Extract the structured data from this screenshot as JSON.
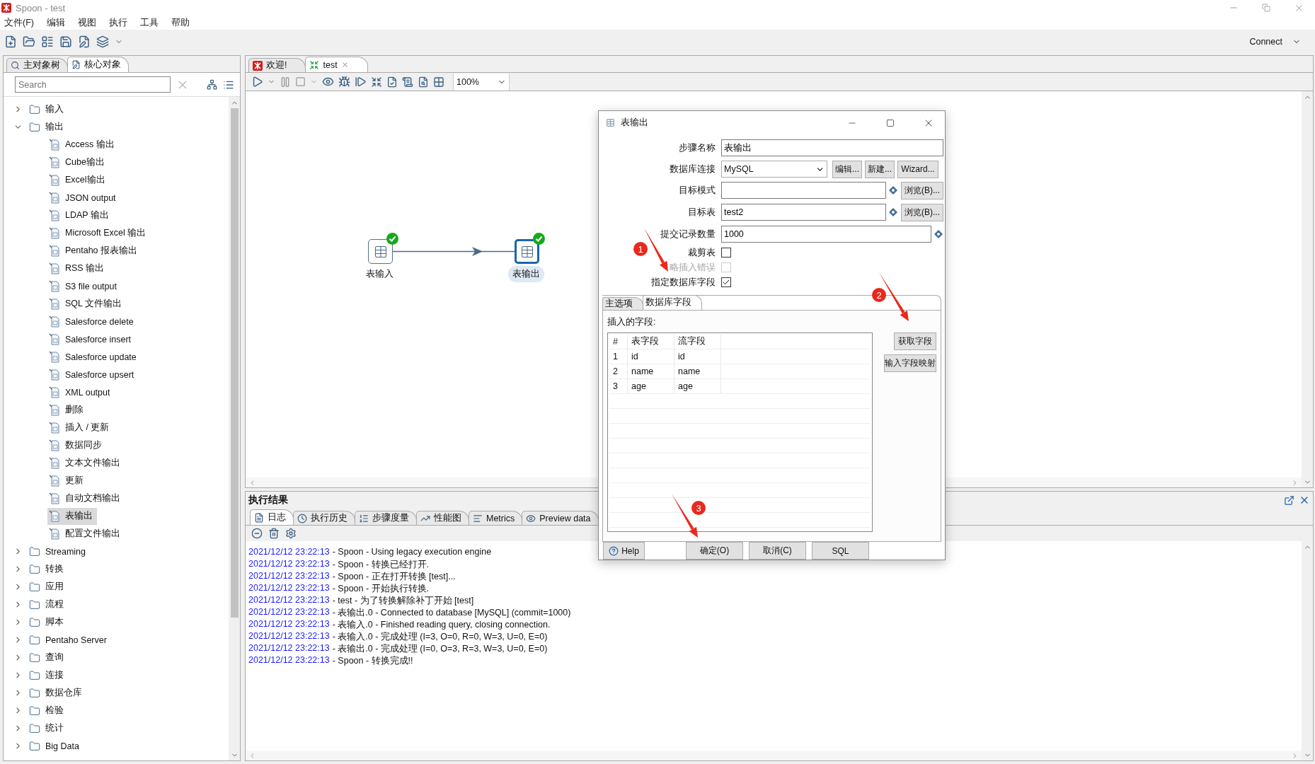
{
  "window": {
    "title": "Spoon - test"
  },
  "menu": [
    "文件(F)",
    "编辑",
    "视图",
    "执行",
    "工具",
    "帮助"
  ],
  "connect": "Connect",
  "left_tabs": [
    {
      "label": "主对象树",
      "selected": false
    },
    {
      "label": "核心对象",
      "selected": true
    }
  ],
  "search": {
    "placeholder": "Search"
  },
  "tree": [
    {
      "label": "输入",
      "expanded": false
    },
    {
      "label": "输出",
      "expanded": true,
      "children": [
        {
          "label": "Access 输出",
          "selected": false
        },
        {
          "label": "Cube输出",
          "selected": false
        },
        {
          "label": "Excel输出",
          "selected": false
        },
        {
          "label": "JSON output",
          "selected": false
        },
        {
          "label": "LDAP 输出",
          "selected": false
        },
        {
          "label": "Microsoft Excel 输出",
          "selected": false
        },
        {
          "label": "Pentaho 报表输出",
          "selected": false
        },
        {
          "label": "RSS 输出",
          "selected": false
        },
        {
          "label": "S3 file output",
          "selected": false
        },
        {
          "label": "SQL 文件输出",
          "selected": false
        },
        {
          "label": "Salesforce delete",
          "selected": false
        },
        {
          "label": "Salesforce insert",
          "selected": false
        },
        {
          "label": "Salesforce update",
          "selected": false
        },
        {
          "label": "Salesforce upsert",
          "selected": false
        },
        {
          "label": "XML output",
          "selected": false
        },
        {
          "label": "删除",
          "selected": false
        },
        {
          "label": "插入 / 更新",
          "selected": false
        },
        {
          "label": "数据同步",
          "selected": false
        },
        {
          "label": "文本文件输出",
          "selected": false
        },
        {
          "label": "更新",
          "selected": false
        },
        {
          "label": "自动文档输出",
          "selected": false
        },
        {
          "label": "表输出",
          "selected": true
        },
        {
          "label": "配置文件输出",
          "selected": false
        }
      ]
    },
    {
      "label": "Streaming",
      "expanded": false
    },
    {
      "label": "转换",
      "expanded": false
    },
    {
      "label": "应用",
      "expanded": false
    },
    {
      "label": "流程",
      "expanded": false
    },
    {
      "label": "脚本",
      "expanded": false
    },
    {
      "label": "Pentaho Server",
      "expanded": false
    },
    {
      "label": "查询",
      "expanded": false
    },
    {
      "label": "连接",
      "expanded": false
    },
    {
      "label": "数据仓库",
      "expanded": false
    },
    {
      "label": "检验",
      "expanded": false
    },
    {
      "label": "统计",
      "expanded": false
    },
    {
      "label": "Big Data",
      "expanded": false
    }
  ],
  "editor_tabs": [
    {
      "label": "欢迎!",
      "selected": false
    },
    {
      "label": "test",
      "selected": true
    }
  ],
  "zoom": "100%",
  "canvas": {
    "nodes": [
      {
        "label": "表输入",
        "selected": false
      },
      {
        "label": "表输出",
        "selected": true
      }
    ]
  },
  "results": {
    "title": "执行结果",
    "tabs": [
      {
        "label": "日志",
        "selected": true
      },
      {
        "label": "执行历史",
        "selected": false
      },
      {
        "label": "步骤度量",
        "selected": false
      },
      {
        "label": "性能图",
        "selected": false
      },
      {
        "label": "Metrics",
        "selected": false
      },
      {
        "label": "Preview data",
        "selected": false
      }
    ],
    "log": [
      {
        "time": "2021/12/12 23:22:13",
        "message": "- Spoon - Using legacy execution engine"
      },
      {
        "time": "2021/12/12 23:22:13",
        "message": "- Spoon - 转换已经打开."
      },
      {
        "time": "2021/12/12 23:22:13",
        "message": "- Spoon - 正在打开转换 [test]..."
      },
      {
        "time": "2021/12/12 23:22:13",
        "message": "- Spoon - 开始执行转换."
      },
      {
        "time": "2021/12/12 23:22:13",
        "message": "- test - 为了转换解除补丁开始  [test]"
      },
      {
        "time": "2021/12/12 23:22:13",
        "message": "- 表输出.0 - Connected to database [MySQL] (commit=1000)"
      },
      {
        "time": "2021/12/12 23:22:13",
        "message": "- 表输入.0 - Finished reading query, closing connection."
      },
      {
        "time": "2021/12/12 23:22:13",
        "message": "- 表输入.0 - 完成处理 (I=3, O=0, R=0, W=3, U=0, E=0)"
      },
      {
        "time": "2021/12/12 23:22:13",
        "message": "- 表输出.0 - 完成处理 (I=0, O=3, R=3, W=3, U=0, E=0)"
      },
      {
        "time": "2021/12/12 23:22:13",
        "message": "- Spoon - 转换完成!!"
      }
    ]
  },
  "dialog": {
    "title": "表输出",
    "rows": [
      {
        "kind": "text",
        "label": "步骤名称",
        "value": "表输出"
      },
      {
        "kind": "select",
        "label": "数据库连接",
        "value": "MySQL",
        "buttons": [
          "编辑...",
          "新建...",
          "Wizard..."
        ]
      },
      {
        "kind": "text",
        "label": "目标模式",
        "variable": true,
        "button": "浏览(B)..."
      },
      {
        "kind": "text",
        "label": "目标表",
        "value": "test2",
        "variable": true,
        "button": "浏览(B)..."
      },
      {
        "kind": "text",
        "label": "提交记录数量",
        "value": "1000",
        "variable": true
      },
      {
        "kind": "checkbox",
        "label": "裁剪表",
        "checked": false,
        "disabled": false
      },
      {
        "kind": "checkbox",
        "label": "略插入错误",
        "checked": false,
        "disabled": true
      },
      {
        "kind": "checkbox",
        "label": "指定数据库字段",
        "checked": true,
        "disabled": false
      }
    ],
    "tabs": [
      {
        "label": "主选项",
        "selected": false
      },
      {
        "label": "数据库字段",
        "selected": true
      }
    ],
    "fields_label": "插入的字段:",
    "table": {
      "columns": [
        "#",
        "表字段",
        "流字段"
      ],
      "rows": [
        [
          "1",
          "id",
          "id"
        ],
        [
          "2",
          "name",
          "name"
        ],
        [
          "3",
          "age",
          "age"
        ]
      ]
    },
    "side_buttons": [
      "获取字段",
      "输入字段映射"
    ],
    "footer": {
      "help": "Help",
      "buttons": [
        "确定(O)",
        "取消(C)",
        "SQL"
      ]
    }
  },
  "annotations": [
    {
      "number": "1"
    },
    {
      "number": "2"
    },
    {
      "number": "3"
    }
  ]
}
